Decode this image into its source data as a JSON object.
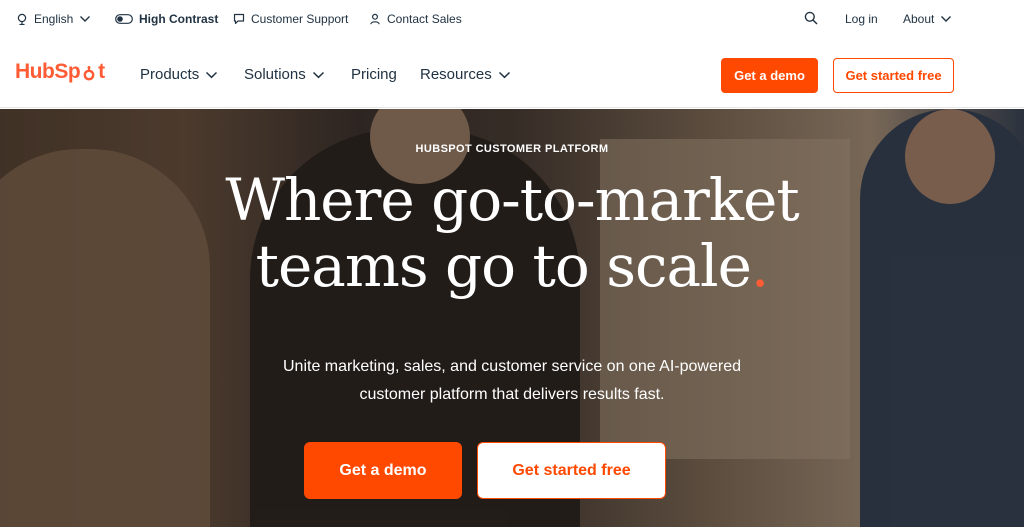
{
  "utility_bar": {
    "language": "English",
    "high_contrast": "High Contrast",
    "customer_support": "Customer Support",
    "contact_sales": "Contact Sales",
    "login": "Log in",
    "about": "About"
  },
  "nav": {
    "logo_text_before": "HubSp",
    "logo_text_after": "t",
    "items": [
      "Products",
      "Solutions",
      "Pricing",
      "Resources"
    ],
    "demo_button": "Get a demo",
    "free_button": "Get started free"
  },
  "hero": {
    "eyebrow": "HUBSPOT CUSTOMER PLATFORM",
    "headline_line1": "Where go-to-market",
    "headline_line2": "teams go to scale",
    "headline_dot": ".",
    "subhead_line1": "Unite marketing, sales, and customer service on one AI-powered",
    "subhead_line2": "customer platform that delivers results fast.",
    "demo_button": "Get a demo",
    "free_button": "Get started free"
  },
  "colors": {
    "brand_orange": "#ff4800",
    "logo_orange": "#ff5c35",
    "text_dark": "#213343"
  },
  "icons": {
    "language": "globe-icon",
    "high_contrast": "toggle-icon",
    "customer_support": "chat-icon",
    "contact_sales": "person-icon",
    "search": "search-icon",
    "dropdown": "chevron-down-icon"
  }
}
